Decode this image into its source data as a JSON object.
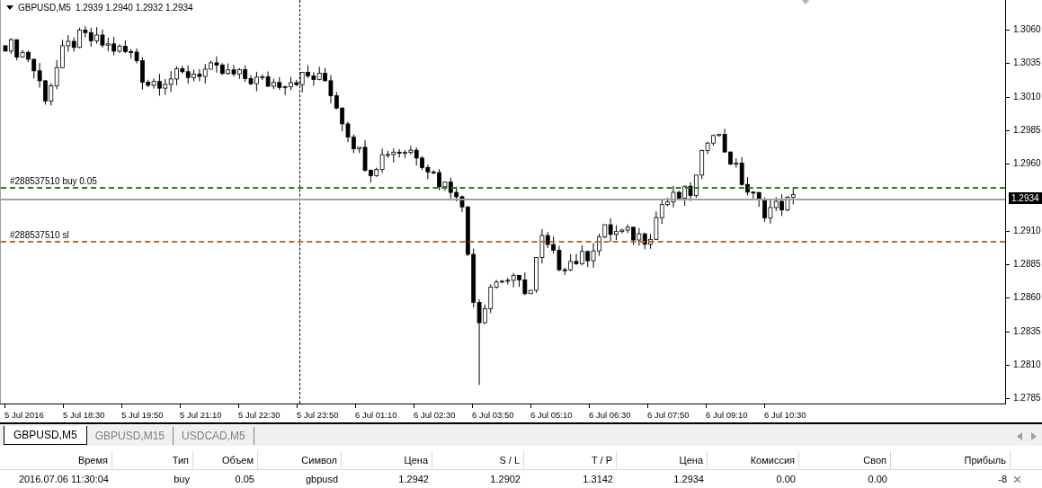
{
  "chart": {
    "symbol": "GBPUSD,M5",
    "quote": "1.2939 1.2940 1.2932 1.2934",
    "order_lines": [
      {
        "kind": "entry",
        "label": "#288537510 buy 0.05",
        "color": "#2a7a2a"
      },
      {
        "kind": "stop_loss",
        "label": "#288537510 sl",
        "color": "#c8691e"
      }
    ],
    "price_axis": [
      "1.3060",
      "1.3035",
      "1.3010",
      "1.2985",
      "1.2960",
      "1.2910",
      "1.2885",
      "1.2860",
      "1.2835",
      "1.2810",
      "1.2785"
    ],
    "current_price": "1.2934",
    "time_axis": [
      "5 Jul 2016",
      "5 Jul 18:30",
      "5 Jul 19:50",
      "5 Jul 21:10",
      "5 Jul 22:30",
      "5 Jul 23:50",
      "6 Jul 01:10",
      "6 Jul 02:30",
      "6 Jul 03:50",
      "6 Jul 05:10",
      "6 Jul 06:30",
      "6 Jul 07:50",
      "6 Jul 09:10",
      "6 Jul 10:30"
    ]
  },
  "tabs": [
    {
      "label": "GBPUSD,M5",
      "selected": true
    },
    {
      "label": "GBPUSD,M15",
      "selected": false
    },
    {
      "label": "USDCAD,M5",
      "selected": false
    }
  ],
  "trades": {
    "columns": [
      "Время",
      "Тип",
      "Объем",
      "Символ",
      "Цена",
      "S / L",
      "T / P",
      "Цена",
      "Комиссия",
      "Своп",
      "Прибыль"
    ],
    "rows": [
      {
        "cells": [
          "2016.07.06 11:30:04",
          "buy",
          "0.05",
          "gbpusd",
          "1.2942",
          "1.2902",
          "1.3142",
          "1.2934",
          "0.00",
          "0.00",
          "-8"
        ]
      }
    ]
  }
}
